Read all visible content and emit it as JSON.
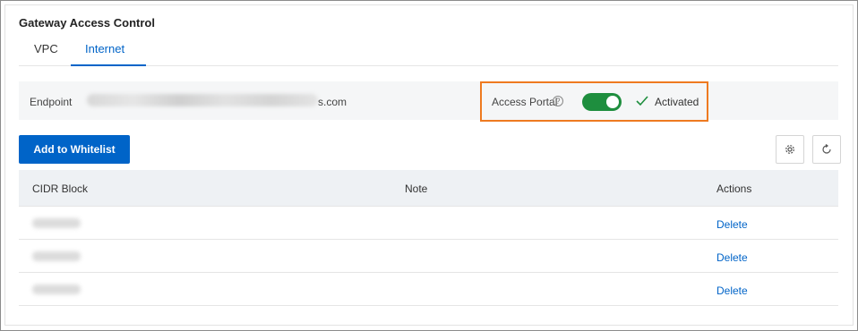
{
  "header": {
    "title": "Gateway Access Control"
  },
  "tabs": [
    {
      "label": "VPC",
      "active": false
    },
    {
      "label": "Internet",
      "active": true
    }
  ],
  "endpoint": {
    "label": "Endpoint",
    "value_suffix": "s.com"
  },
  "access_portal": {
    "label": "Access Portal",
    "help_icon": "question-circle-icon",
    "enabled": true,
    "status_icon": "check-icon",
    "status_text": "Activated"
  },
  "toolbar": {
    "add_label": "Add to Whitelist",
    "settings_icon": "gear-icon",
    "refresh_icon": "refresh-icon"
  },
  "table": {
    "columns": [
      "CIDR Block",
      "Note",
      "Actions"
    ],
    "rows": [
      {
        "action": "Delete"
      },
      {
        "action": "Delete"
      },
      {
        "action": "Delete"
      }
    ]
  },
  "colors": {
    "primary": "#0064c8",
    "toggle_on": "#1e8e3e",
    "highlight_border": "#ee7a20"
  }
}
